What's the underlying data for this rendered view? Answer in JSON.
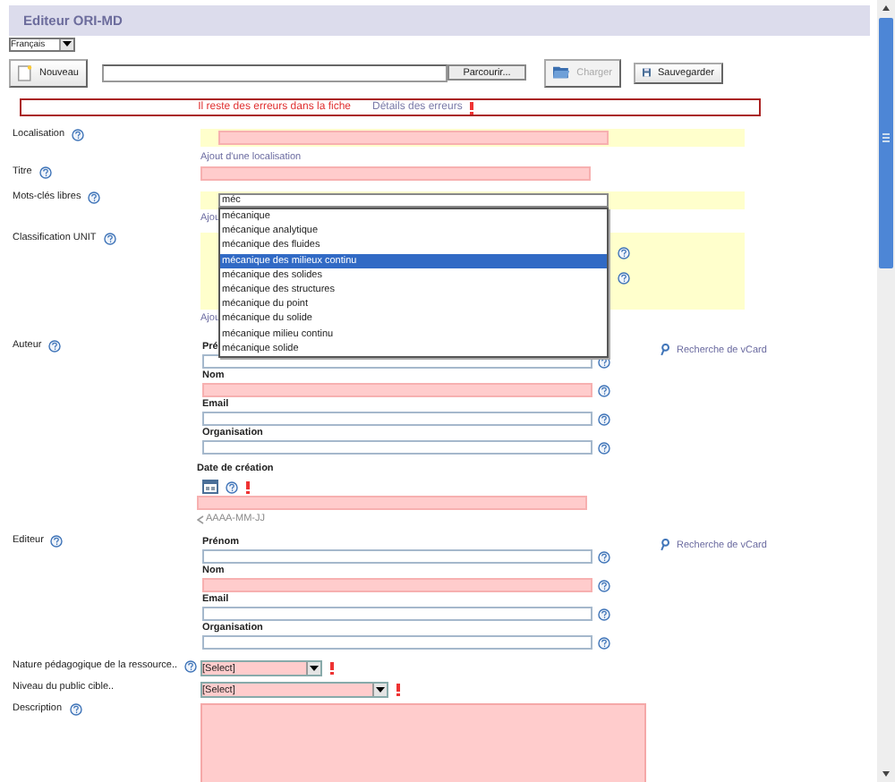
{
  "window": {
    "title": "Editeur ORI-MD"
  },
  "language": {
    "value": "Français"
  },
  "toolbar": {
    "new_button": "Nouveau",
    "browse_button": "Parcourir...",
    "load_button": {
      "label": "Charger",
      "disabled": true
    },
    "save_button": "Sauvegarder"
  },
  "error_banner": {
    "message": "Il reste des erreurs dans la fiche",
    "details_link": "Détails des erreurs"
  },
  "localisation": {
    "label": "Localisation",
    "invalid": true,
    "add_link": "Ajout d'une localisation"
  },
  "titre": {
    "label": "Titre",
    "invalid": true
  },
  "keywords": {
    "label": "Mots-clés libres",
    "value": "méc",
    "add_link": "Ajou",
    "suggestions": [
      {
        "text": "mécanique",
        "selected": false
      },
      {
        "text": "mécanique analytique",
        "selected": false
      },
      {
        "text": "mécanique des fluides",
        "selected": false
      },
      {
        "text": "mécanique des milieux continu",
        "selected": true
      },
      {
        "text": "mécanique des solides",
        "selected": false
      },
      {
        "text": "mécanique des structures",
        "selected": false
      },
      {
        "text": "mécanique du point",
        "selected": false
      },
      {
        "text": "mécanique du solide",
        "selected": false
      },
      {
        "text": "mécanique milieu continu",
        "selected": false
      },
      {
        "text": "mécanique solide",
        "selected": false
      }
    ]
  },
  "classification": {
    "label": "Classification UNIT",
    "add_link": "Ajou"
  },
  "author": {
    "label": "Auteur",
    "vcard_link": "Recherche de vCard",
    "fields": [
      {
        "label": "Pré",
        "invalid": false
      },
      {
        "label": "Nom",
        "invalid": true
      },
      {
        "label": "Email",
        "invalid": false
      },
      {
        "label": "Organisation",
        "invalid": false
      }
    ]
  },
  "creation_date": {
    "label": "Date de création",
    "invalid": true,
    "required": true,
    "hint": "AAAA-MM-JJ"
  },
  "editor": {
    "label": "Editeur",
    "vcard_link": "Recherche de vCard",
    "fields": [
      {
        "label": "Prénom",
        "invalid": false
      },
      {
        "label": "Nom",
        "invalid": true
      },
      {
        "label": "Email",
        "invalid": false
      },
      {
        "label": "Organisation",
        "invalid": false
      }
    ]
  },
  "selects": [
    {
      "label": "Nature pédagogique de la ressource..",
      "help": true,
      "value": "[Select]",
      "invalid": true,
      "required": true,
      "wide": false
    },
    {
      "label": "Niveau du public cible..",
      "help": false,
      "value": "[Select]",
      "invalid": true,
      "required": true,
      "wide": true
    }
  ],
  "description": {
    "label": "Description",
    "invalid": true
  }
}
